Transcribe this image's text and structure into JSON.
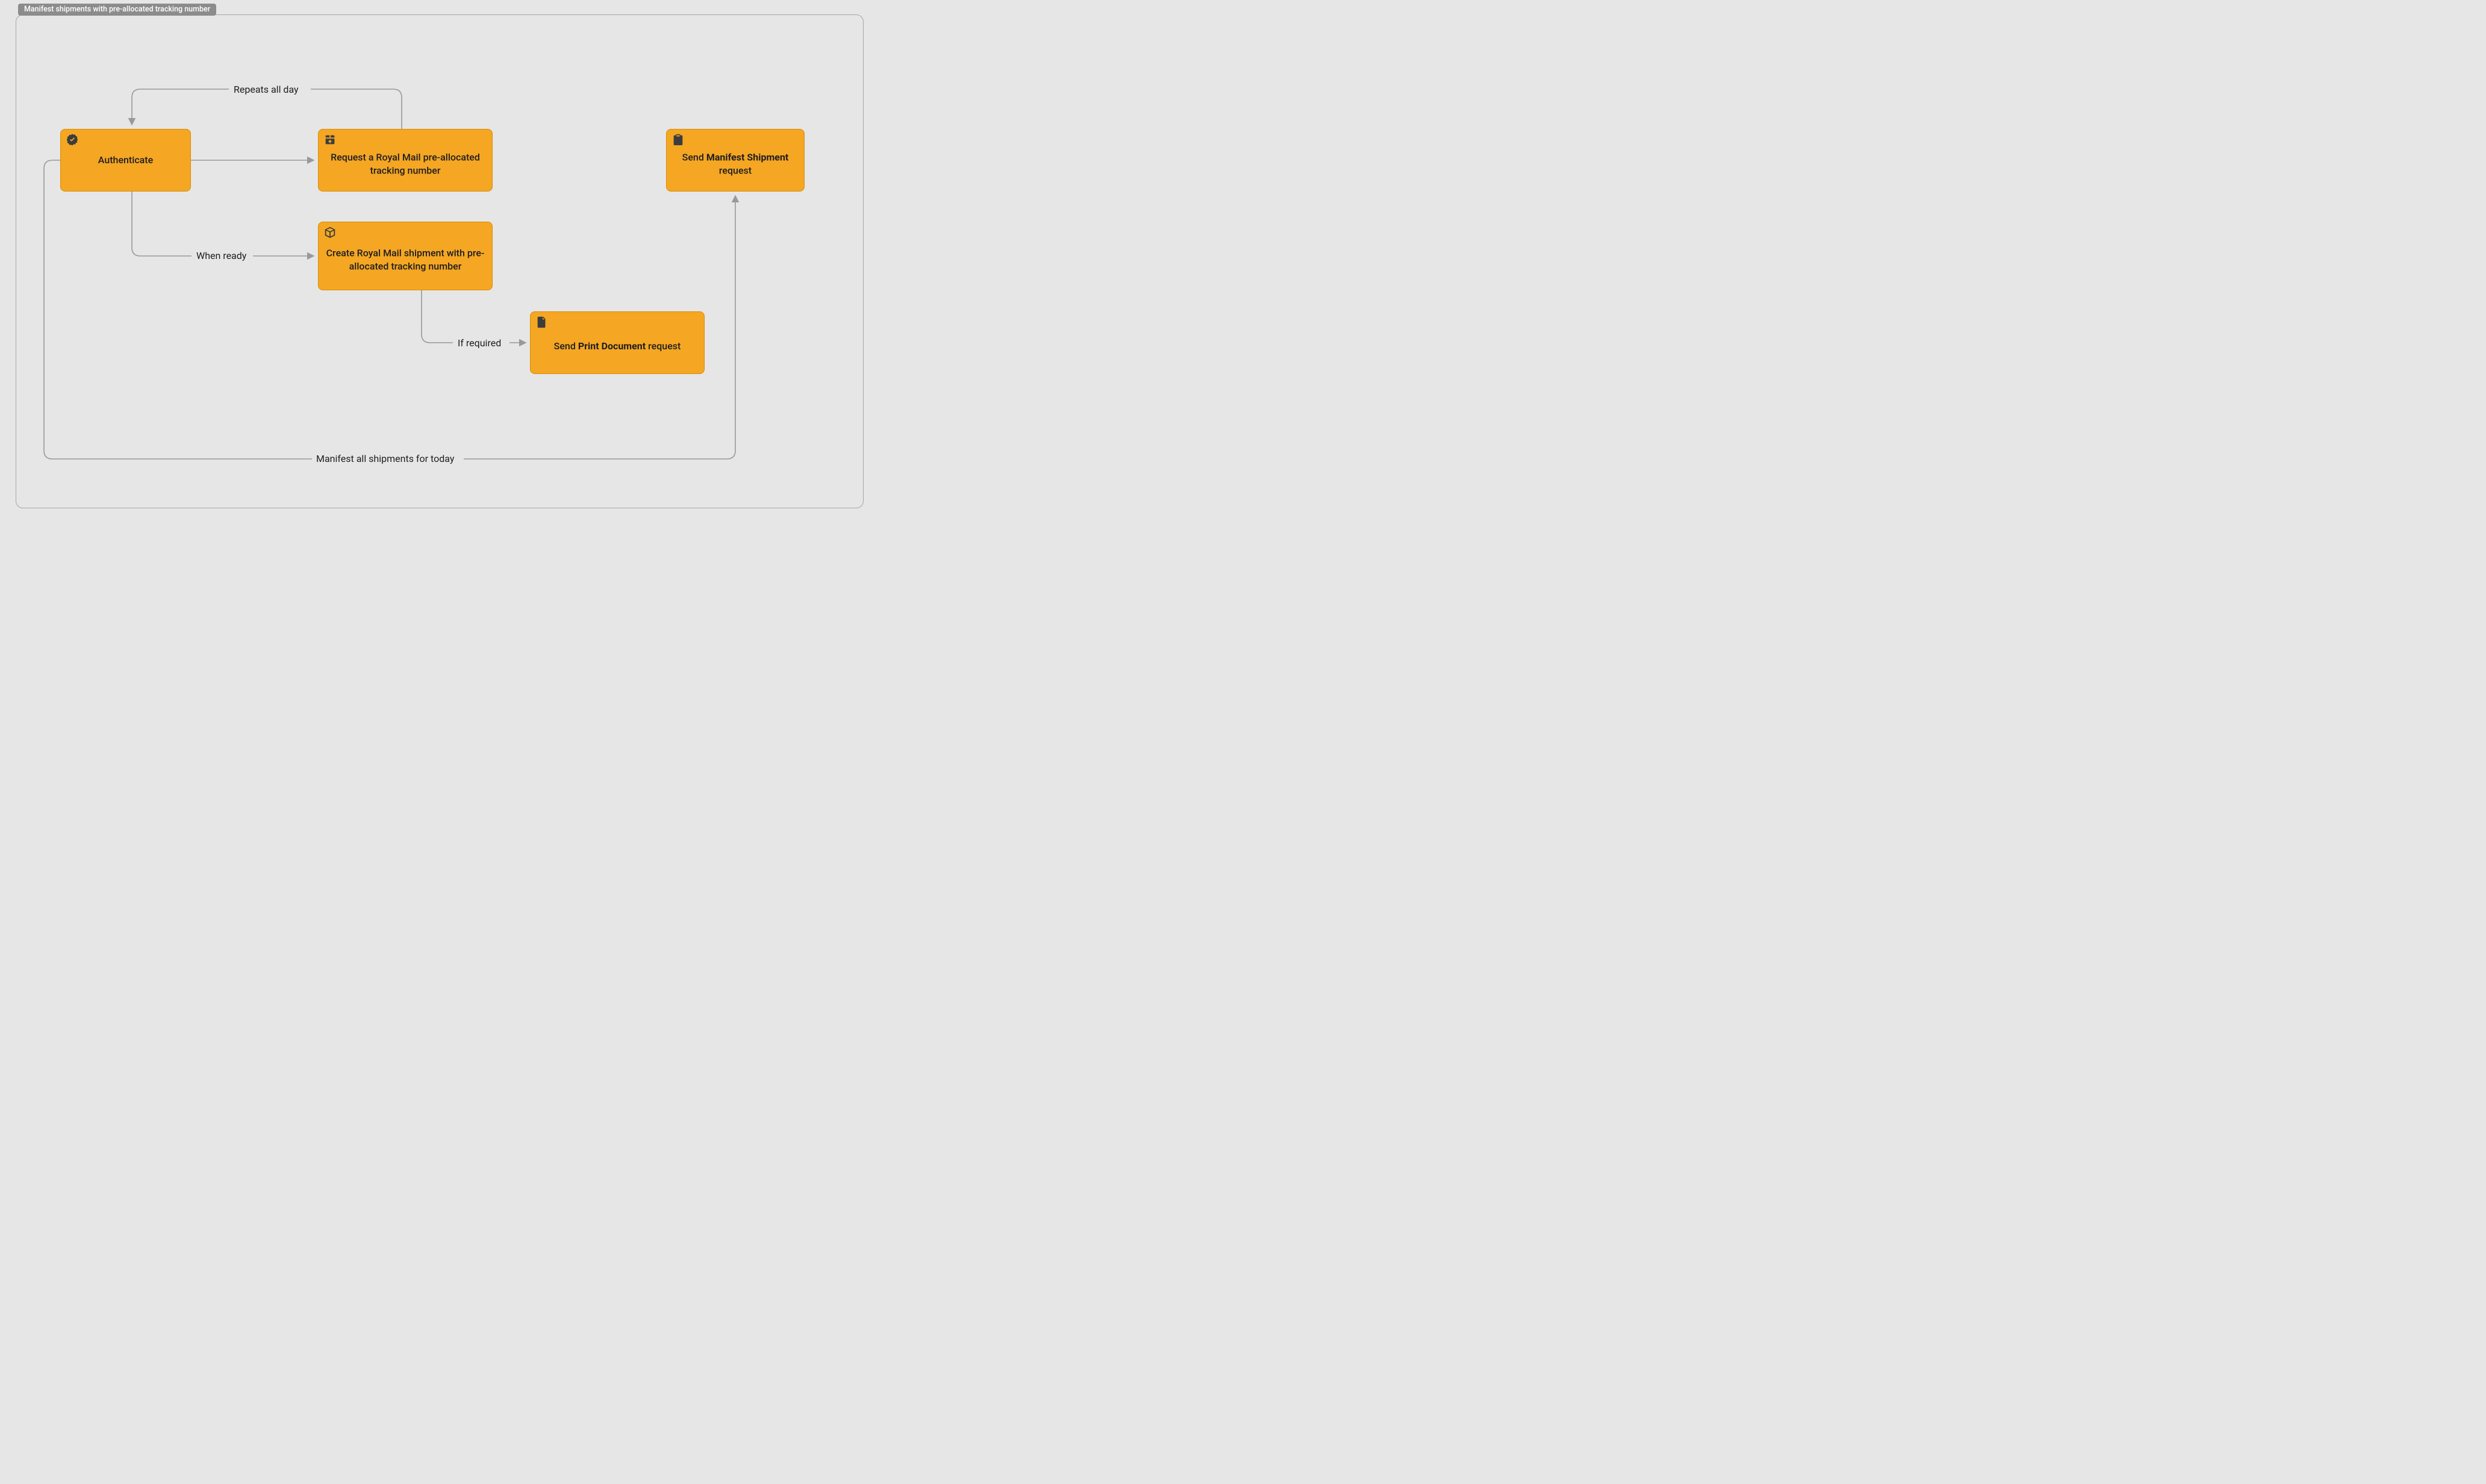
{
  "diagram": {
    "title": "Manifest shipments with pre-allocated tracking number",
    "nodes": {
      "authenticate": {
        "text": "Authenticate",
        "icon": "verified-badge-icon"
      },
      "request_tracking": {
        "text": "Request a Royal Mail pre-allocated tracking number",
        "icon": "package-add-icon"
      },
      "create_shipment": {
        "text": "Create Royal Mail shipment with pre-allocated tracking number",
        "icon": "box-icon"
      },
      "print_doc": {
        "text_html": "Send <b>Print Document</b> request",
        "icon": "document-icon"
      },
      "manifest": {
        "text_html": "Send <b>Manifest Shipment</b> request",
        "icon": "clipboard-icon"
      }
    },
    "edges": {
      "repeats": {
        "label": "Repeats all day"
      },
      "when_ready": {
        "label": "When ready"
      },
      "if_required": {
        "label": "If required"
      },
      "manifest_all": {
        "label": "Manifest all shipments for today"
      }
    }
  },
  "colors": {
    "node_bg": "#f5a623",
    "node_border": "#d88e06",
    "bg": "#e6e6e6",
    "arrow": "#999999",
    "title_bg": "#8c8c8c"
  }
}
